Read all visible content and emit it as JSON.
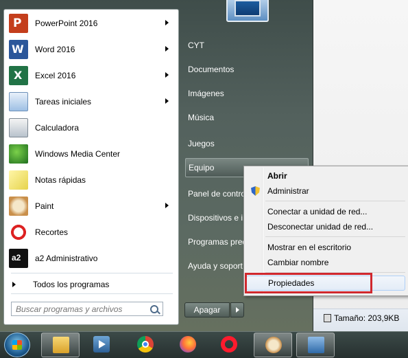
{
  "start_menu": {
    "programs": [
      {
        "label": "PowerPoint 2016",
        "icon": "powerpoint-icon",
        "has_submenu": true
      },
      {
        "label": "Word 2016",
        "icon": "word-icon",
        "has_submenu": true
      },
      {
        "label": "Excel 2016",
        "icon": "excel-icon",
        "has_submenu": true
      },
      {
        "label": "Tareas iniciales",
        "icon": "getting-started-icon",
        "has_submenu": true
      },
      {
        "label": "Calculadora",
        "icon": "calculator-icon",
        "has_submenu": false
      },
      {
        "label": "Windows Media Center",
        "icon": "media-center-icon",
        "has_submenu": false
      },
      {
        "label": "Notas rápidas",
        "icon": "sticky-notes-icon",
        "has_submenu": false
      },
      {
        "label": "Paint",
        "icon": "paint-icon",
        "has_submenu": true
      },
      {
        "label": "Recortes",
        "icon": "snipping-tool-icon",
        "has_submenu": false
      },
      {
        "label": "a2 Administrativo",
        "icon": "a2-icon",
        "has_submenu": false
      }
    ],
    "all_programs": "Todos los programas",
    "search_placeholder": "Buscar programas y archivos",
    "right_items": [
      {
        "label": "CYT"
      },
      {
        "label": "Documentos"
      },
      {
        "label": "Imágenes"
      },
      {
        "label": "Música"
      },
      {
        "label": "Juegos"
      },
      {
        "label": "Equipo"
      },
      {
        "label": "Panel de contro"
      },
      {
        "label": "Dispositivos e i"
      },
      {
        "label": "Programas pred"
      },
      {
        "label": "Ayuda y soport"
      }
    ],
    "shutdown_label": "Apagar"
  },
  "context_menu": {
    "items": [
      {
        "label": "Abrir",
        "bold": true
      },
      {
        "label": "Administrar",
        "icon": "shield-icon"
      },
      {
        "label": "Conectar a unidad de red..."
      },
      {
        "label": "Desconectar unidad de red..."
      },
      {
        "label": "Mostrar en el escritorio"
      },
      {
        "label": "Cambiar nombre"
      },
      {
        "label": "Propiedades",
        "highlighted": true
      }
    ],
    "highlight_color": "#d0282e"
  },
  "status_bar": {
    "size_text": "Tamaño: 203,9KB"
  },
  "taskbar": {
    "buttons": [
      "start-orb-icon",
      "explorer-icon",
      "media-player-icon",
      "chrome-icon",
      "firefox-icon",
      "opera-icon",
      "paint-icon",
      "network-icon"
    ]
  }
}
